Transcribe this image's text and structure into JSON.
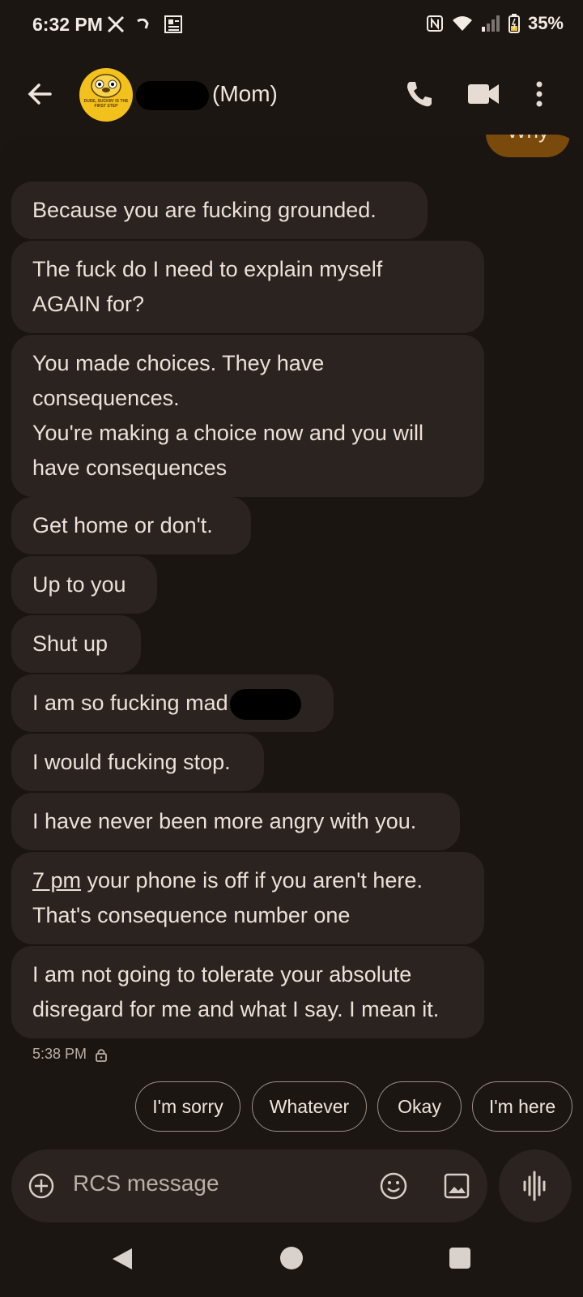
{
  "status_bar": {
    "time": "6:32 PM",
    "battery": "35%",
    "icons": [
      "x-logo-icon",
      "cast-icon",
      "news-icon",
      "nfc-icon",
      "wifi-icon",
      "signal-icon",
      "battery-charging-icon"
    ]
  },
  "header": {
    "contact_name": "(Mom)",
    "avatar_caption": "DUDE, SUCKIN' IS THE FIRST STEP",
    "actions": [
      "back-icon",
      "phone-icon",
      "video-icon",
      "more-icon"
    ]
  },
  "thread": {
    "partial_sent": "Why",
    "messages": [
      {
        "text": "Because you are fucking grounded."
      },
      {
        "text": "The fuck do I need to explain myself\nAGAIN for?"
      },
      {
        "text": "You made choices. They have\nconsequences.\nYou're making a choice now and you will\nhave consequences"
      },
      {
        "text": "Get home or don't."
      },
      {
        "text": "Up to you"
      },
      {
        "text": "Shut up"
      },
      {
        "text": "I am so fucking mad"
      },
      {
        "text": "I would fucking stop."
      },
      {
        "text": "I have never been more angry with you."
      },
      {
        "link": "7 pm",
        "text": " your phone is off if you aren't here.\nThat's consequence number one"
      },
      {
        "text": "I am not going to tolerate your absolute\ndisregard for me and what I say. I mean it."
      }
    ],
    "timestamp": "5:38 PM"
  },
  "suggestions": [
    "I'm sorry",
    "Whatever",
    "Okay",
    "I'm here"
  ],
  "composer": {
    "placeholder": "RCS message"
  },
  "colors": {
    "background": "#1c1613",
    "bubble": "#2a2320",
    "sent_bubble": "#7a4a0c",
    "avatar": "#f3c11c"
  }
}
